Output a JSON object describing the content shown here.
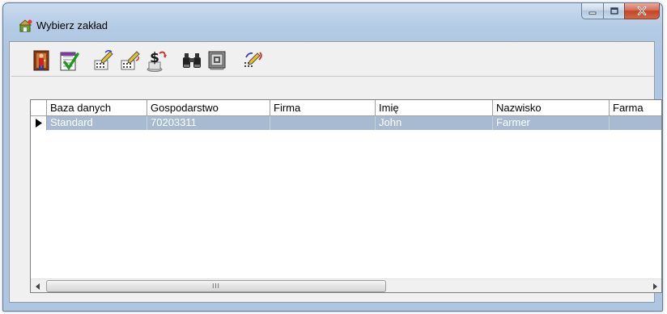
{
  "window": {
    "title": "Wybierz zakład"
  },
  "toolbar": {
    "buttons": [
      {
        "icon": "exit-door-icon"
      },
      {
        "icon": "checklist-icon"
      },
      {
        "icon": "edit-table-icon"
      },
      {
        "icon": "edit-table-2-icon"
      },
      {
        "icon": "dollar-sign-icon"
      },
      {
        "icon": "binoculars-icon"
      },
      {
        "icon": "safe-icon"
      },
      {
        "icon": "edit-link-icon"
      }
    ]
  },
  "grid": {
    "columns": [
      "Baza danych",
      "Gospodarstwo",
      "Firma",
      "Imię",
      "Nazwisko",
      "Farma"
    ],
    "rows": [
      [
        "Standard",
        "70203311",
        "",
        "John",
        "Farmer",
        ""
      ]
    ],
    "scroll_grip": "III"
  },
  "colors": {
    "selection": "#a6bbd2",
    "close_button": "#c24429"
  }
}
